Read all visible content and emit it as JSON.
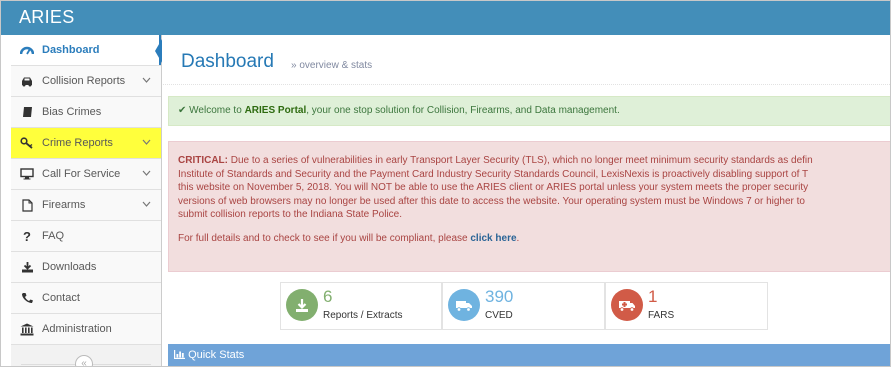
{
  "app": {
    "brand": "ARIES"
  },
  "sidebar": {
    "items": [
      {
        "label": "Dashboard",
        "icon": "dashboard-icon",
        "has_submenu": false,
        "active": true
      },
      {
        "label": "Collision Reports",
        "icon": "car-icon",
        "has_submenu": true
      },
      {
        "label": "Bias Crimes",
        "icon": "book-icon",
        "has_submenu": false
      },
      {
        "label": "Crime Reports",
        "icon": "key-icon",
        "has_submenu": true,
        "highlighted": true
      },
      {
        "label": "Call For Service",
        "icon": "desktop-icon",
        "has_submenu": true
      },
      {
        "label": "Firearms",
        "icon": "file-icon",
        "has_submenu": true
      },
      {
        "label": "FAQ",
        "icon": "question-icon",
        "has_submenu": false
      },
      {
        "label": "Downloads",
        "icon": "download-icon",
        "has_submenu": false
      },
      {
        "label": "Contact",
        "icon": "phone-icon",
        "has_submenu": false
      },
      {
        "label": "Administration",
        "icon": "bank-icon",
        "has_submenu": false
      }
    ],
    "collapse_glyph": "«"
  },
  "header": {
    "title": "Dashboard",
    "subtitle": "» overview & stats"
  },
  "alerts": {
    "welcome": {
      "prefix": "✔ Welcome to ",
      "brand": "ARIES Portal",
      "suffix": ", your one stop solution for Collision, Firearms, and Data management."
    },
    "critical": {
      "label": "CRITICAL:",
      "line1": " Due to a series of vulnerabilities in early Transport Layer Security (TLS), which no longer meet minimum security standards as defin",
      "line2": "Institute of Standards and Security and the Payment Card Industry Security Standards Council, LexisNexis is proactively disabling support of T",
      "line3": "this website on November 5, 2018. You will NOT be able to use the ARIES client or ARIES portal unless your system meets the proper security",
      "line4": "versions of web browsers may no longer be used after this date to access the website. Your operating system must be Windows 7 or higher to",
      "line5": "submit collision reports to the Indiana State Police.",
      "details_prefix": "For full details and to check to see if you will be compliant, please ",
      "details_link": "click here",
      "details_suffix": "."
    }
  },
  "stats": [
    {
      "value": "6",
      "label": "Reports / Extracts",
      "icon": "download-icon",
      "color": "#82af6f"
    },
    {
      "value": "390",
      "label": "CVED",
      "icon": "truck-icon",
      "color": "#6fb3e0"
    },
    {
      "value": "1",
      "label": "FARS",
      "icon": "ambulance-icon",
      "color": "#d15b47"
    }
  ],
  "quick_stats": {
    "label": "Quick Stats",
    "icon": "bar-chart-icon"
  },
  "colors": {
    "brand_bar": "#438eb9",
    "active_nav": "#2b7dbc",
    "highlight": "#ffff3c",
    "success_bg": "#dff0d8",
    "danger_bg": "#f2dede",
    "quickstats_bg": "#6fa3d8"
  }
}
